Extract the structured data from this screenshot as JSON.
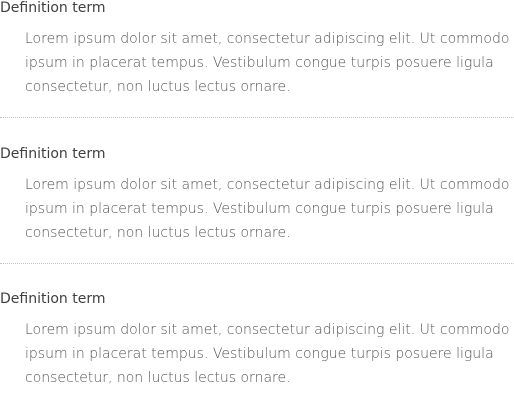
{
  "definitions": [
    {
      "term": "Definition term",
      "description": "Lorem ipsum dolor sit amet, consectetur adipiscing elit. Ut commodo ipsum in placerat tempus. Vestibulum congue turpis posuere ligula consectetur, non luctus lectus ornare."
    },
    {
      "term": "Definition term",
      "description": "Lorem ipsum dolor sit amet, consectetur adipiscing elit. Ut commodo ipsum in placerat tempus. Vestibulum congue turpis posuere ligula consectetur, non luctus lectus ornare."
    },
    {
      "term": "Definition term",
      "description": "Lorem ipsum dolor sit amet, consectetur adipiscing elit. Ut commodo ipsum in placerat tempus. Vestibulum congue turpis posuere ligula consectetur, non luctus lectus ornare."
    }
  ]
}
